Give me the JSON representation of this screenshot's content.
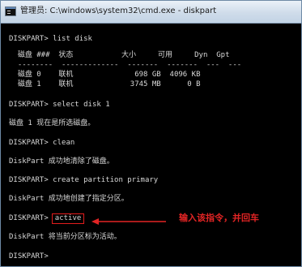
{
  "window": {
    "title": "管理员: C:\\windows\\system32\\cmd.exe - diskpart"
  },
  "console": {
    "lines": [
      "DISKPART> list disk",
      "  磁盘 ###  状态           大小     可用     Dyn  Gpt",
      "  --------  -------------  -------  -------  ---  ---",
      "  磁盘 0    联机              698 GB  4096 KB",
      "  磁盘 1    联机             3745 MB      0 B",
      "DISKPART> select disk 1",
      "磁盘 1 现在是所选磁盘。",
      "DISKPART> clean",
      "DiskPart 成功地清除了磁盘。",
      "DISKPART> create partition primary",
      "DiskPart 成功地创建了指定分区。",
      "DISKPART>",
      "DiskPart 将当前分区标为活动。",
      "DISKPART>"
    ],
    "highlighted_command": "active"
  },
  "annotation": {
    "text": "输入该指令，并回车",
    "color": "#e22424"
  }
}
